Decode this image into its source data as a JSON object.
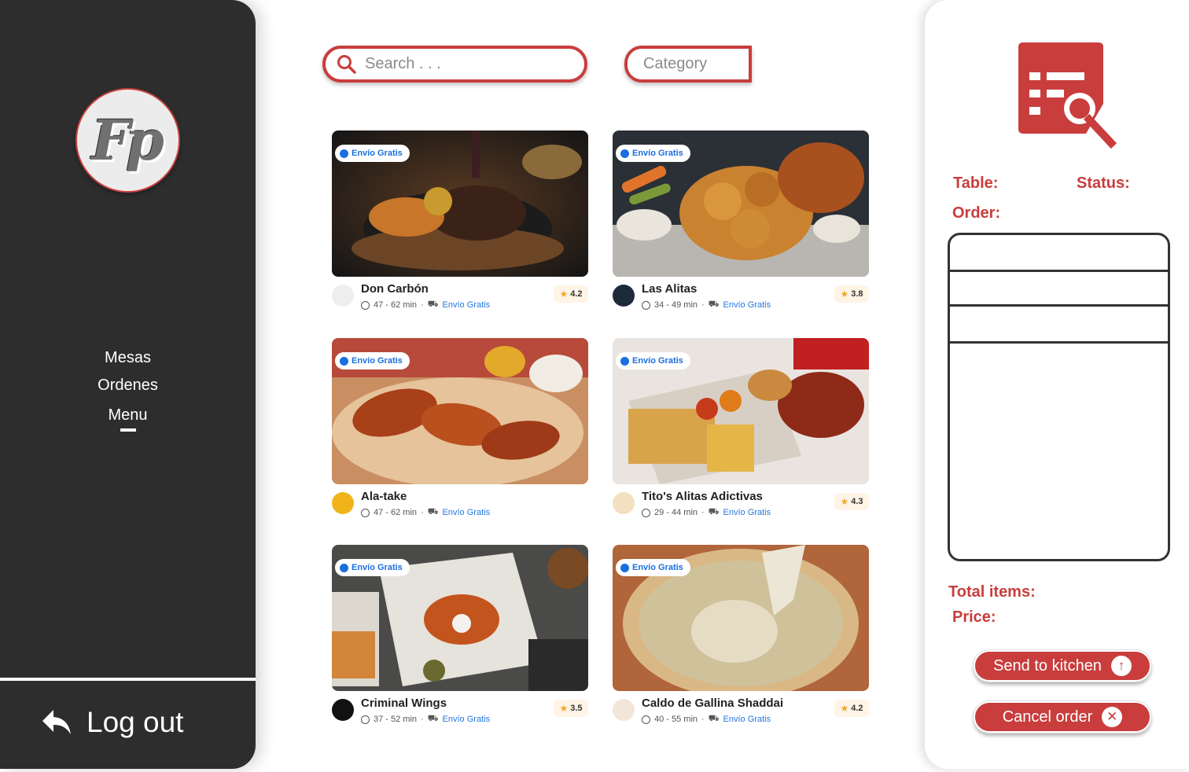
{
  "sidebar": {
    "logo_text": "Fp",
    "nav": [
      {
        "label": "Mesas"
      },
      {
        "label": "Ordenes"
      },
      {
        "label": "Menu"
      }
    ],
    "logout_label": "Log out"
  },
  "search": {
    "placeholder": "Search . . ."
  },
  "category": {
    "label": "Category"
  },
  "restaurants": [
    {
      "name": "Don Carbón",
      "time": "47 - 62 min",
      "delivery": "Envío Gratis",
      "badge": "Envío Gratis",
      "rating": "4.2",
      "icon": "steak-photo"
    },
    {
      "name": "Las Alitas",
      "time": "34 - 49 min",
      "delivery": "Envío Gratis",
      "badge": "Envío Gratis",
      "rating": "3.8",
      "icon": "chicken-photo"
    },
    {
      "name": "Ala-take",
      "time": "47 - 62 min",
      "delivery": "Envío Gratis",
      "badge": "Envío Gratis",
      "rating": "",
      "icon": "wings-photo"
    },
    {
      "name": "Tito's Alitas Adictivas",
      "time": "29 - 44 min",
      "delivery": "Envío Gratis",
      "badge": "Envío Gratis",
      "rating": "4.3",
      "icon": "platter-photo"
    },
    {
      "name": "Criminal Wings",
      "time": "37 - 52 min",
      "delivery": "Envío Gratis",
      "badge": "Envío Gratis",
      "rating": "3.5",
      "icon": "wings-table-photo"
    },
    {
      "name": "Caldo de Gallina Shaddai",
      "time": "40 - 55 min",
      "delivery": "Envío Gratis",
      "badge": "Envío Gratis",
      "rating": "4.2",
      "icon": "soup-photo"
    }
  ],
  "order_panel": {
    "table_label": "Table:",
    "status_label": "Status:",
    "order_label": "Order:",
    "total_items_label": "Total items:",
    "price_label": "Price:",
    "send_label": "Send to kitchen",
    "cancel_label": "Cancel order"
  },
  "colors": {
    "accent": "#c93d3d",
    "sidebar": "#2d2d2d",
    "link": "#2277e0"
  }
}
